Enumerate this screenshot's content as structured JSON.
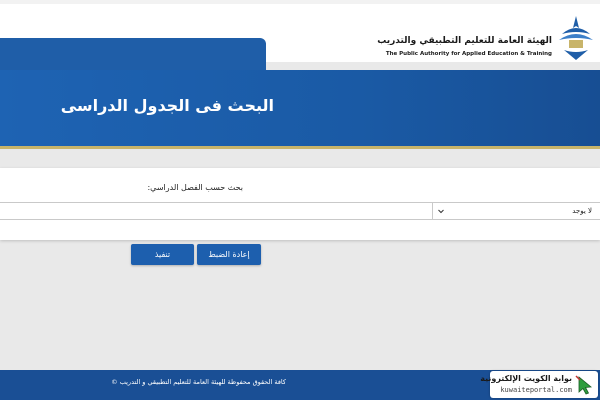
{
  "header": {
    "logo_ar": "الهيئة العامة للتعليم التطبيقي والتدريب",
    "logo_en": "The Public Authority for Applied Education & Training"
  },
  "banner": {
    "title": "البحث فى الجدول الدراسى"
  },
  "search": {
    "label": "بحث حسب الفصل الدراسي:",
    "select_value": "لا يوجد"
  },
  "buttons": {
    "reset": "إعادة الضبط",
    "execute": "تنفيذ"
  },
  "footer": {
    "copyright": "كافة الحقوق محفوظة للهيئة العامة للتعليم التطبيقي و التدريب ©"
  },
  "badge": {
    "ar": "بوابة الكويت الإلكترونية",
    "en": "kuwaiteportal.com"
  },
  "colors": {
    "primary": "#1f5ea8",
    "footer": "#1a4f95",
    "accent_line": "#c8b46a"
  }
}
